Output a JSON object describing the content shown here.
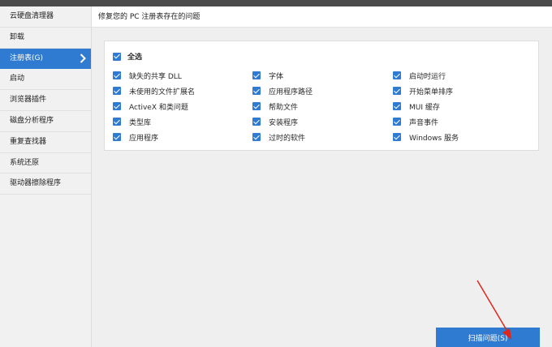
{
  "sidebar": {
    "items": [
      {
        "label": "云硬盘清理器"
      },
      {
        "label": "卸载"
      },
      {
        "label": "注册表(G)"
      },
      {
        "label": "启动"
      },
      {
        "label": "浏览器插件"
      },
      {
        "label": "磁盘分析程序"
      },
      {
        "label": "重复查找器"
      },
      {
        "label": "系统还原"
      },
      {
        "label": "驱动器擦除程序"
      }
    ]
  },
  "header": {
    "title": "修复您的 PC 注册表存在的问题"
  },
  "options": {
    "select_all": "全选",
    "items": [
      {
        "label": "缺失的共享 DLL",
        "checked": true
      },
      {
        "label": "字体",
        "checked": true
      },
      {
        "label": "启动时运行",
        "checked": true
      },
      {
        "label": "未使用的文件扩展名",
        "checked": true
      },
      {
        "label": "应用程序路径",
        "checked": true
      },
      {
        "label": "开始菜单排序",
        "checked": true
      },
      {
        "label": "ActiveX 和类问题",
        "checked": true
      },
      {
        "label": "帮助文件",
        "checked": true
      },
      {
        "label": "MUI 缓存",
        "checked": true
      },
      {
        "label": "类型库",
        "checked": true
      },
      {
        "label": "安装程序",
        "checked": true
      },
      {
        "label": "声音事件",
        "checked": true
      },
      {
        "label": "应用程序",
        "checked": true
      },
      {
        "label": "过时的软件",
        "checked": true
      },
      {
        "label": "Windows 服务",
        "checked": true
      }
    ]
  },
  "footer": {
    "scan_label": "扫描问题(S)"
  },
  "colors": {
    "accent": "#2f7bd1",
    "annotation_arrow": "#e0261c"
  }
}
